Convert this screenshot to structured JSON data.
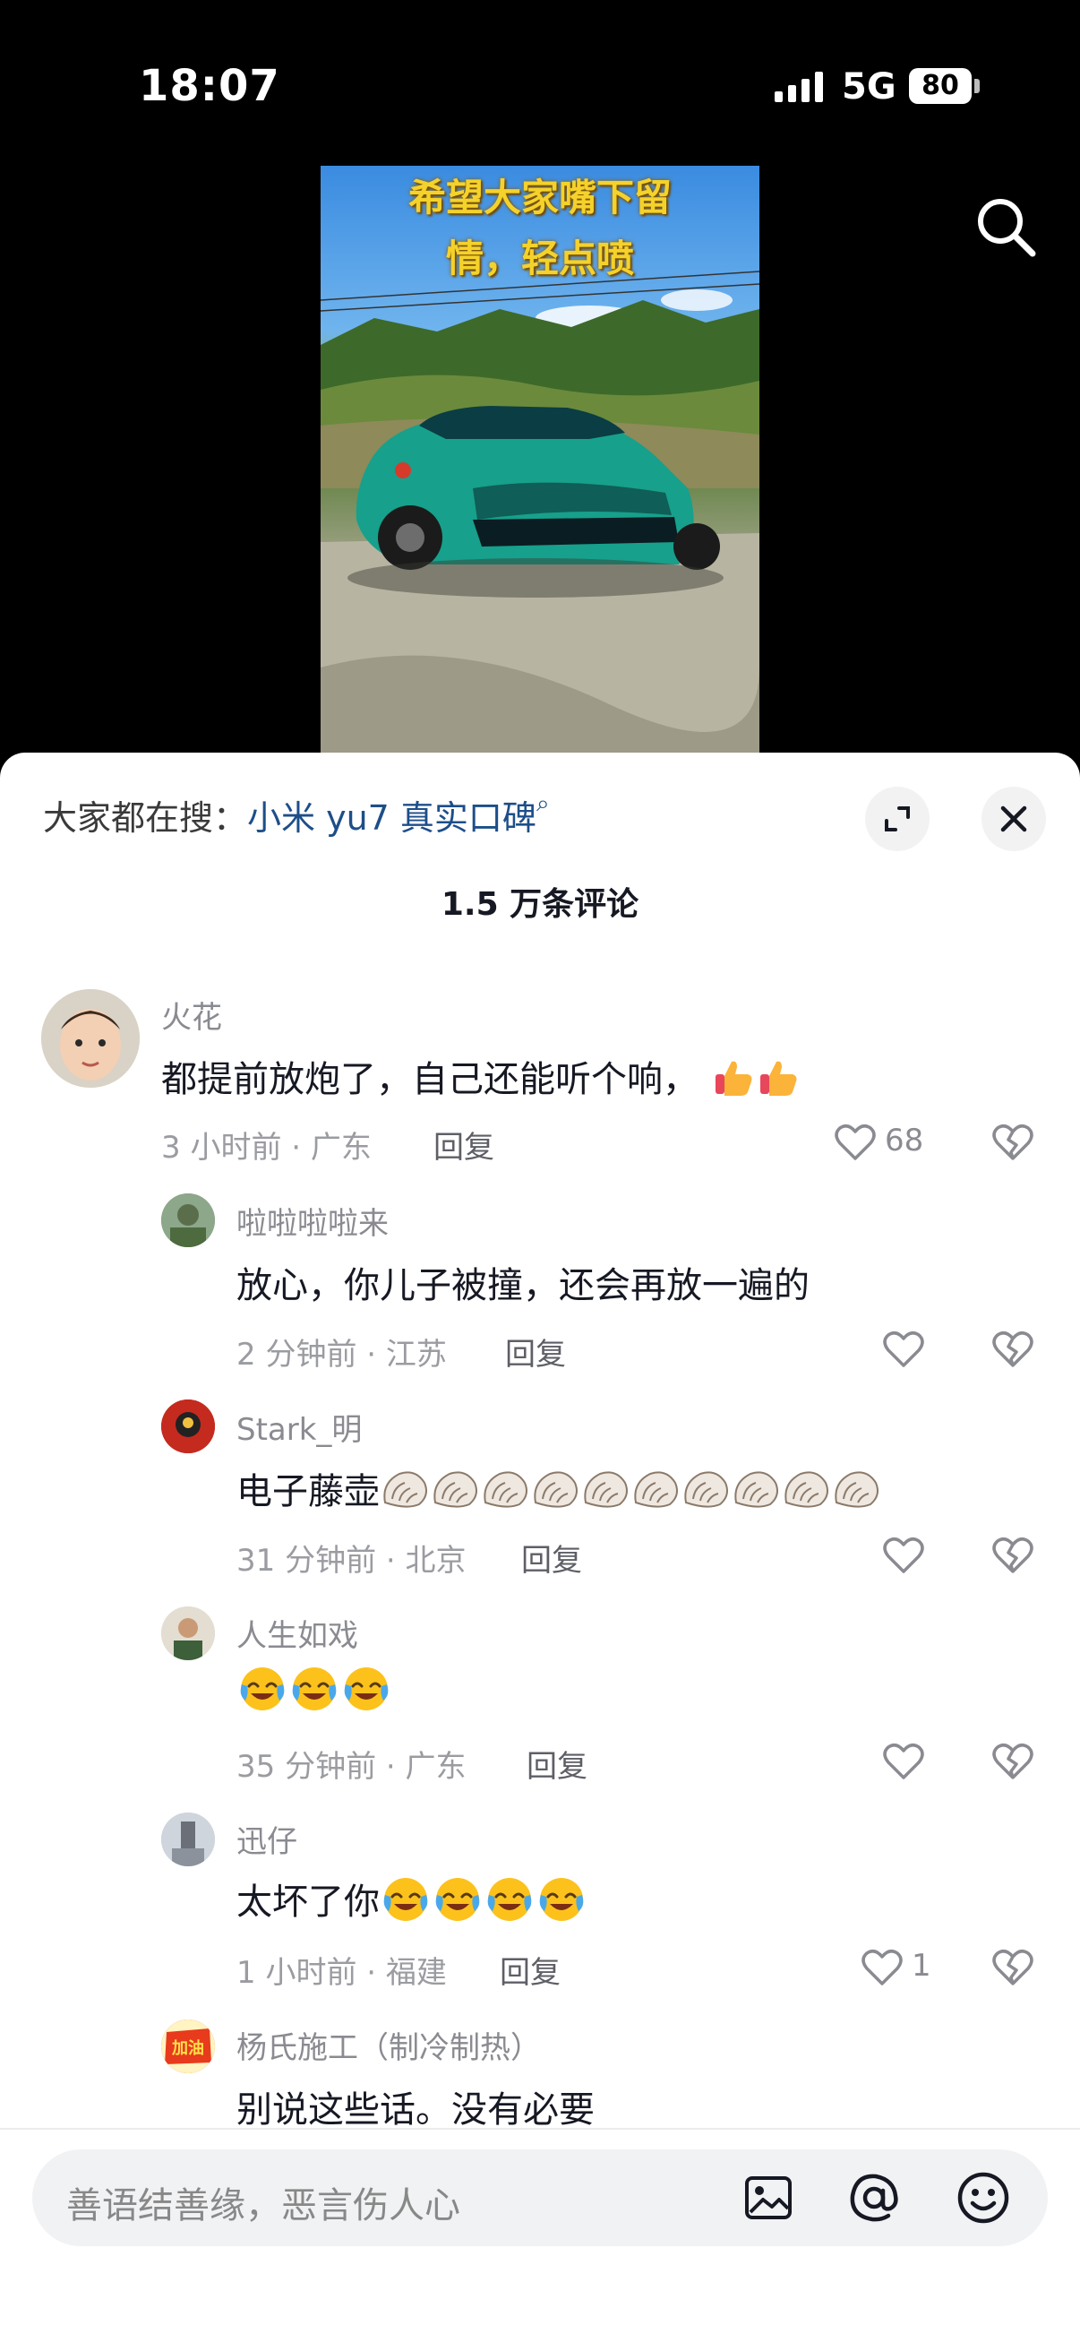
{
  "status_bar": {
    "time": "18:07",
    "network": "5G",
    "battery": "80"
  },
  "video": {
    "caption_line1": "希望大家嘴下留",
    "caption_line2": "情，轻点喷"
  },
  "sheet": {
    "search_prefix": "大家都在搜：",
    "search_keyword": "小米 yu7 真实口碑",
    "comment_count": "1.5 万条评论"
  },
  "comments": [
    {
      "user": "火花",
      "text": "都提前放炮了，自己还能听个响，",
      "emoji_icon": "thumbs-up",
      "emoji_count": 2,
      "time": "3 小时前 · 广东",
      "reply": "回复",
      "likes": "68"
    },
    {
      "user": "啦啦啦啦来",
      "text": "放心，你儿子被撞，还会再放一遍的",
      "time": "2 分钟前 · 江苏",
      "reply": "回复",
      "likes": ""
    },
    {
      "user": "Stark_明",
      "text": "电子藤壶",
      "emoji_icon": "seashell",
      "emoji_count": 10,
      "time": "31 分钟前 · 北京",
      "reply": "回复",
      "likes": ""
    },
    {
      "user": "人生如戏",
      "text": "",
      "emoji_icon": "laughing-crying",
      "emoji_count": 3,
      "time": "35 分钟前 · 广东",
      "reply": "回复",
      "likes": ""
    },
    {
      "user": "迅仔",
      "text": "太坏了你",
      "emoji_icon": "laughing-crying",
      "emoji_count": 4,
      "time": "1 小时前 · 福建",
      "reply": "回复",
      "likes": "1"
    },
    {
      "user": "杨氏施工（制冷制热）",
      "text": "别说这些话。没有必要",
      "avatar_badge": "加油"
    }
  ],
  "input_bar": {
    "placeholder": "善语结善缘，恶言伤人心"
  },
  "colors": {
    "keyword_blue": "#1d4e89",
    "car_teal": "#1a9e8a"
  }
}
